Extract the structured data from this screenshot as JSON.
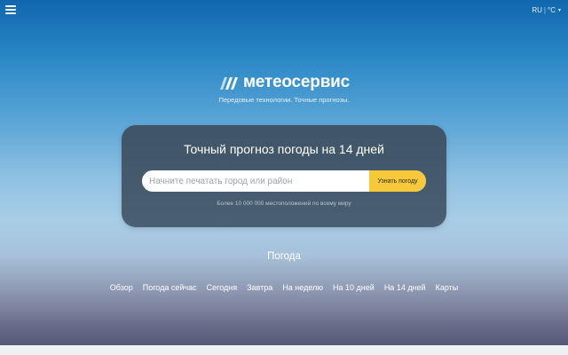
{
  "header": {
    "language": "RU",
    "separator": "|",
    "unit": "°C"
  },
  "brand": {
    "name": "метеосервис",
    "tagline": "Передовые технологии. Точные прогнозы."
  },
  "search": {
    "title": "Точный прогноз погоды на 14 дней",
    "placeholder": "Начните печатать город или район",
    "button_label": "Узнать погоду",
    "note": "Более 10 000 000 местоположений по всему миру"
  },
  "weather": {
    "heading": "Погода",
    "links": [
      "Обзор",
      "Погода сейчас",
      "Сегодня",
      "Завтра",
      "На неделю",
      "На 10 дней",
      "На 14 дней",
      "Карты"
    ]
  },
  "colors": {
    "accent_button": "#f7c839",
    "card_background": "#46596b"
  },
  "icons": {
    "menu": "menu-icon",
    "caret": "chevron-down-icon",
    "logo": "logo-icon"
  }
}
